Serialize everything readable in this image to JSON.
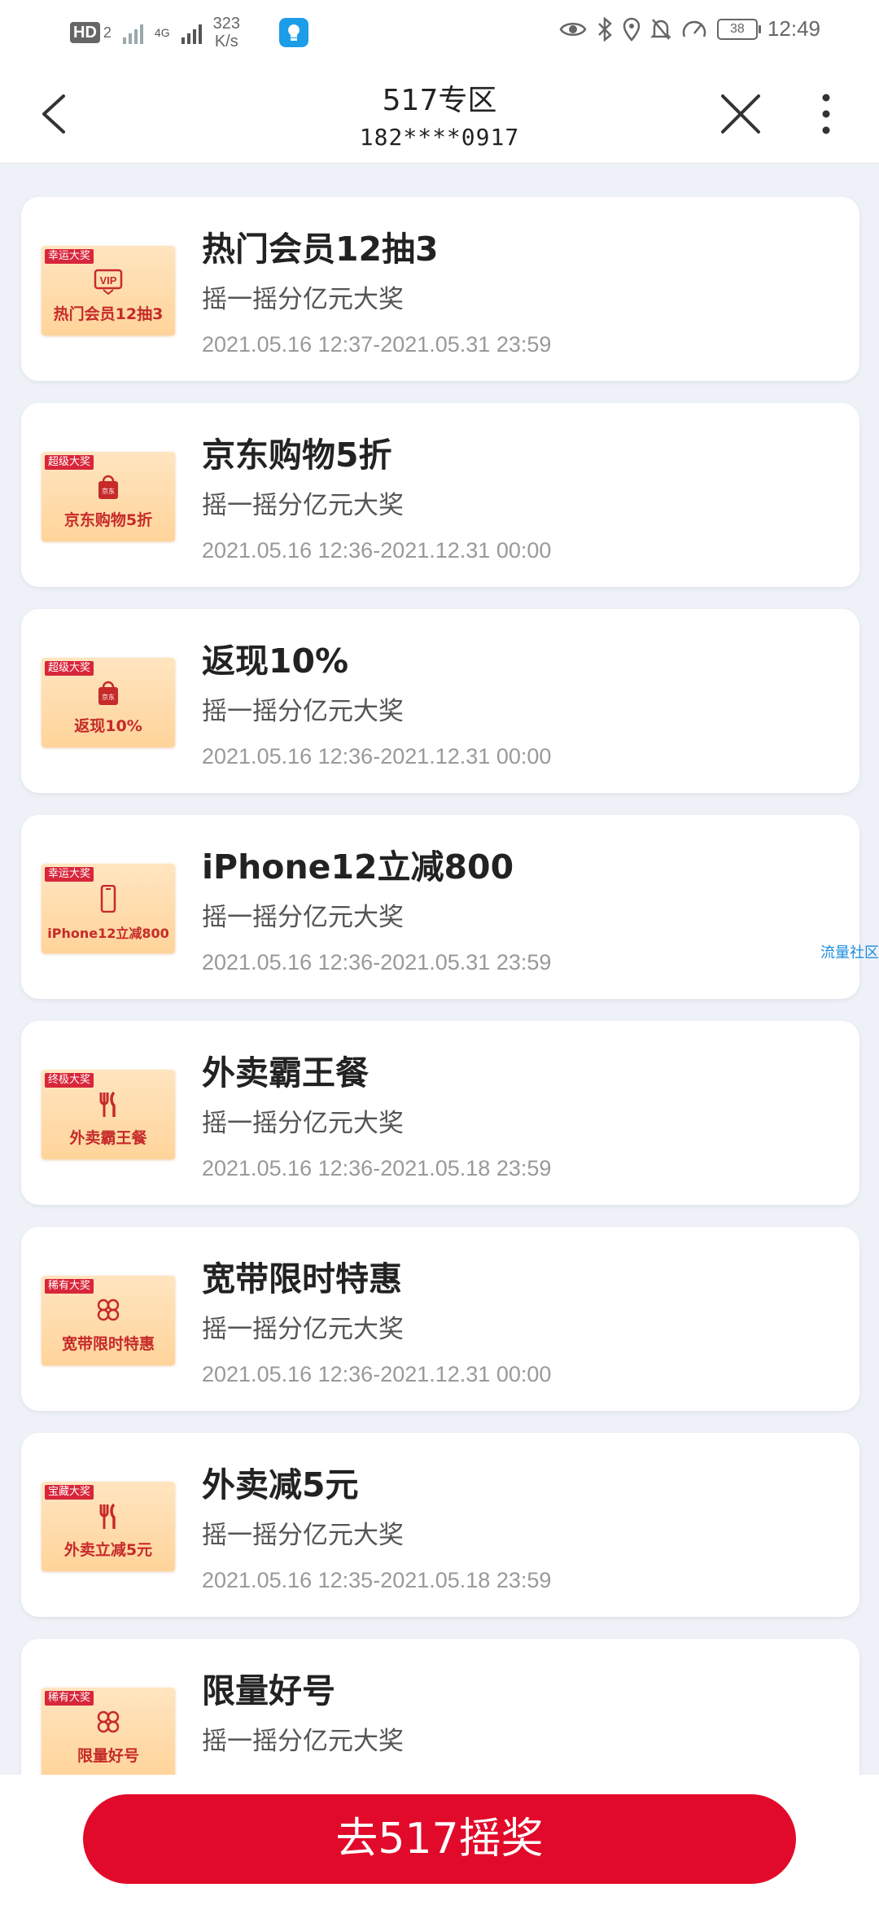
{
  "status_bar": {
    "hd_label": "HD",
    "hd_sub": "2",
    "net_label": "4G",
    "speed_value": "323",
    "speed_unit": "K/s",
    "battery": "38",
    "time": "12:49"
  },
  "nav": {
    "title": "517专区",
    "subtitle": "182****0917"
  },
  "prizes": [
    {
      "tag": "幸运大奖",
      "thumb_text": "热门会员12抽3",
      "icon": "vip-icon",
      "title": "热门会员12抽3",
      "desc": "摇一摇分亿元大奖",
      "time": "2021.05.16 12:37-2021.05.31 23:59"
    },
    {
      "tag": "超级大奖",
      "thumb_text": "京东购物5折",
      "icon": "shopping-bag-icon",
      "title": "京东购物5折",
      "desc": "摇一摇分亿元大奖",
      "time": "2021.05.16 12:36-2021.12.31 00:00"
    },
    {
      "tag": "超级大奖",
      "thumb_text": "返现10%",
      "icon": "shopping-bag-icon",
      "title": "返现10%",
      "desc": "摇一摇分亿元大奖",
      "time": "2021.05.16 12:36-2021.12.31 00:00"
    },
    {
      "tag": "幸运大奖",
      "thumb_text": "iPhone12立减800",
      "icon": "phone-icon",
      "title": "iPhone12立减800",
      "desc": "摇一摇分亿元大奖",
      "time": "2021.05.16 12:36-2021.05.31 23:59"
    },
    {
      "tag": "终极大奖",
      "thumb_text": "外卖霸王餐",
      "icon": "fork-knife-icon",
      "title": "外卖霸王餐",
      "desc": "摇一摇分亿元大奖",
      "time": "2021.05.16 12:36-2021.05.18 23:59"
    },
    {
      "tag": "稀有大奖",
      "thumb_text": "宽带限时特惠",
      "icon": "unicom-logo-icon",
      "title": "宽带限时特惠",
      "desc": "摇一摇分亿元大奖",
      "time": "2021.05.16 12:36-2021.12.31 00:00"
    },
    {
      "tag": "宝藏大奖",
      "thumb_text": "外卖立减5元",
      "icon": "fork-knife-icon",
      "title": "外卖减5元",
      "desc": "摇一摇分亿元大奖",
      "time": "2021.05.16 12:35-2021.05.18 23:59"
    },
    {
      "tag": "稀有大奖",
      "thumb_text": "限量好号",
      "icon": "unicom-logo-icon",
      "title": "限量好号",
      "desc": "摇一摇分亿元大奖",
      "time": ""
    }
  ],
  "watermark": "流量社区",
  "cta": {
    "label": "去517摇奖"
  },
  "colors": {
    "accent": "#e20a2a",
    "tag_red": "#d8263b",
    "thumb_bg": "#ffd49a"
  }
}
